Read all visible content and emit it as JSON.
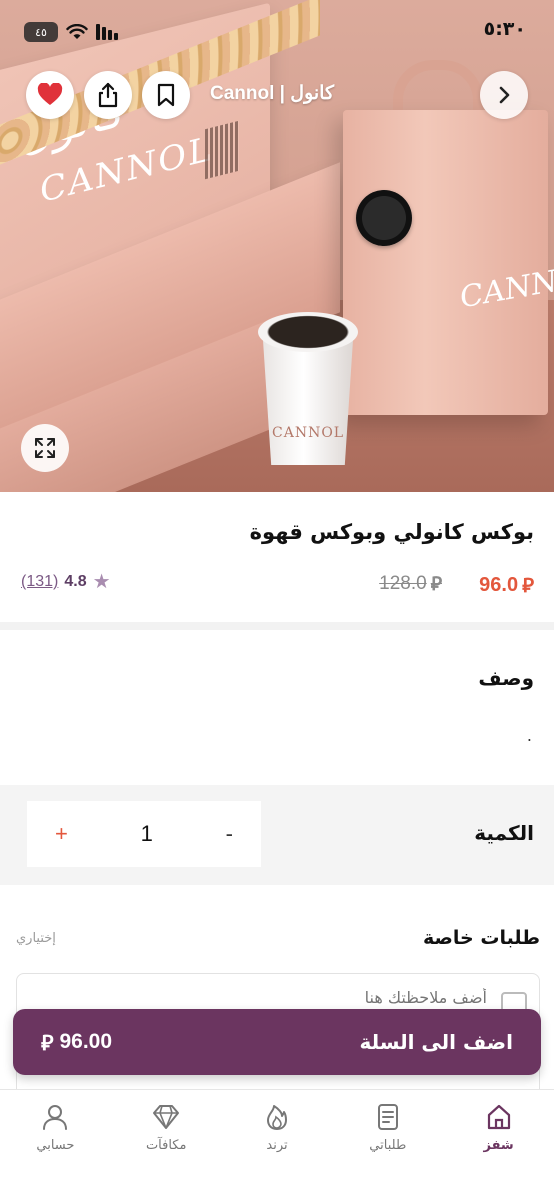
{
  "status_bar": {
    "time": "٥:٣٠",
    "battery": "٤٥"
  },
  "header": {
    "store_name": "Cannol | كانول"
  },
  "hero": {
    "lid_text": "CANNOL",
    "lid_text_ar": "كانول",
    "bag_text": "CANNO",
    "cup_text": "CANNOL",
    "tray_mark": "C"
  },
  "product": {
    "title": "بوكس كانولي وبوكس قهوة",
    "price_now": "96.0",
    "price_old": "128.0",
    "currency_symbol": "⃁",
    "rating_value": "4.8",
    "rating_count": "(131)"
  },
  "description": {
    "title": "وصف",
    "text": "."
  },
  "quantity": {
    "label": "الكمية",
    "value": "1",
    "plus": "+",
    "minus": "-"
  },
  "special_requests": {
    "title": "طلبات خاصة",
    "optional": "إختياري",
    "placeholder": "أضف ملاحظتك هنا"
  },
  "cart": {
    "label": "اضف الى السلة",
    "price": "96.00"
  },
  "bottom_nav": {
    "items": [
      {
        "label": "شفز",
        "icon": "home-icon",
        "active": true
      },
      {
        "label": "طلباتي",
        "icon": "orders-icon",
        "active": false
      },
      {
        "label": "ترند",
        "icon": "flame-icon",
        "active": false
      },
      {
        "label": "مكافآت",
        "icon": "diamond-icon",
        "active": false
      },
      {
        "label": "حسابي",
        "icon": "user-icon",
        "active": false
      }
    ]
  },
  "colors": {
    "accent": "#6b3560",
    "price": "#e3573c",
    "favorite": "#e0323a"
  }
}
